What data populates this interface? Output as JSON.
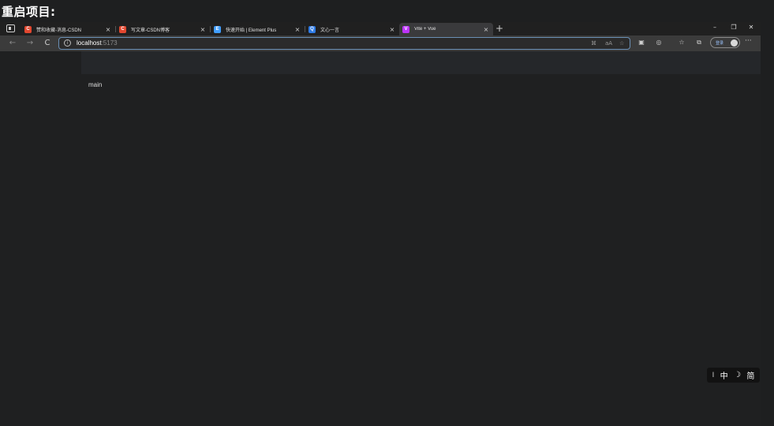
{
  "caption": "重启项目:",
  "browser": {
    "tabs": [
      {
        "title": "赞和收藏-消息-CSDN",
        "favicon_color": "#e2472f",
        "favicon_letter": "C",
        "active": false
      },
      {
        "title": "写文章-CSDN博客",
        "favicon_color": "#e2472f",
        "favicon_letter": "C",
        "active": false
      },
      {
        "title": "快速开始 | Element Plus",
        "favicon_color": "#409eff",
        "favicon_letter": "E",
        "active": false
      },
      {
        "title": "文心一言",
        "favicon_color": "#2e7be6",
        "favicon_letter": "Q",
        "active": false
      },
      {
        "title": "Vite + Vue",
        "favicon_color": "#bd34fe",
        "favicon_letter": "V",
        "active": true
      }
    ],
    "close_glyph": "×",
    "new_tab_glyph": "+",
    "window_controls": {
      "minimize": "–",
      "restore": "❐",
      "close": "✕"
    },
    "nav": {
      "back": "←",
      "forward": "→",
      "reload": "C"
    },
    "address": {
      "host": "localhost",
      "port": ":5173"
    },
    "login_label": "登录",
    "more_glyph": "···",
    "icons": [
      "tab-actions-icon",
      "info-icon",
      "reader-mode-icon",
      "translate-icon",
      "favorite-add-icon",
      "copilot-icon",
      "game-icon",
      "favorites-icon",
      "collections-icon",
      "profile-avatar-icon"
    ]
  },
  "page": {
    "main_text": "main"
  },
  "ime": {
    "cursor": "I",
    "lang": "中",
    "mode": "☽",
    "script": "简"
  },
  "colors": {
    "background": "#1e1f20",
    "header_band": "#25272a",
    "address_border": "#6a8fb5",
    "csdn_red": "#e2472f",
    "vite_purple": "#bd34fe"
  }
}
